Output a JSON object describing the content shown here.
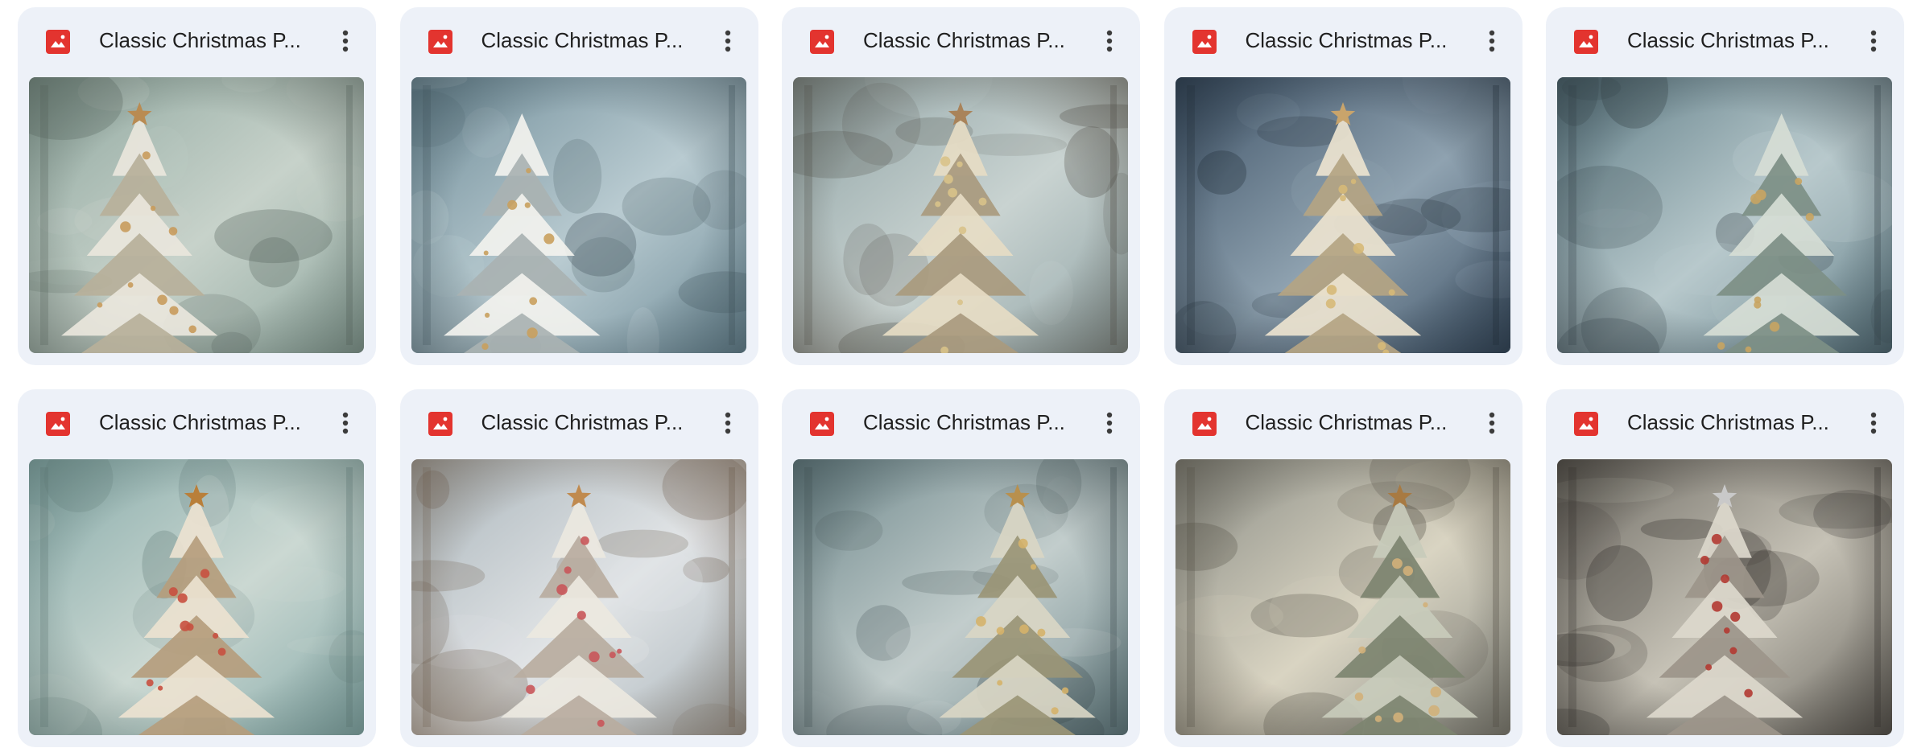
{
  "files": [
    {
      "title": "Classic Christmas P...",
      "icon": "image-file-icon",
      "menu_icon": "more-vert-icon",
      "preview": {
        "bg1": "#8fa79f",
        "bg2": "#c7d2ca",
        "shade": "#4f5c55",
        "tree": "#e9e6dc",
        "tree_dark": "#b7b09a",
        "star": "#b98b52",
        "tree_pos": "left",
        "ornament": "#c89b5c"
      }
    },
    {
      "title": "Classic Christmas P...",
      "icon": "image-file-icon",
      "menu_icon": "more-vert-icon",
      "preview": {
        "bg1": "#6f8c98",
        "bg2": "#b9cbd1",
        "shade": "#3d4f57",
        "tree": "#f2f2ee",
        "tree_dark": "#a9b2b2",
        "star": "",
        "tree_pos": "left",
        "ornament": "#c9a05e"
      }
    },
    {
      "title": "Classic Christmas P...",
      "icon": "image-file-icon",
      "menu_icon": "more-vert-icon",
      "preview": {
        "bg1": "#8ea2a4",
        "bg2": "#c9d3d1",
        "shade": "#4d4a42",
        "tree": "#e6dcc4",
        "tree_dark": "#a99a7e",
        "star": "#a9835a",
        "tree_pos": "center",
        "ornament": "#d8c28a"
      }
    },
    {
      "title": "Classic Christmas P...",
      "icon": "image-file-icon",
      "menu_icon": "more-vert-icon",
      "preview": {
        "bg1": "#3e5266",
        "bg2": "#8fa2b0",
        "shade": "#1f2a35",
        "tree": "#ece3cf",
        "tree_dark": "#b4a483",
        "star": "#c9a46b",
        "tree_pos": "center",
        "ornament": "#d6b978"
      }
    },
    {
      "title": "Classic Christmas P...",
      "icon": "image-file-icon",
      "menu_icon": "more-vert-icon",
      "preview": {
        "bg1": "#5f7c86",
        "bg2": "#b8c9cc",
        "shade": "#2f3c42",
        "tree": "#d6ddd5",
        "tree_dark": "#7d8f86",
        "star": "",
        "tree_pos": "right",
        "ornament": "#c8a462"
      }
    },
    {
      "title": "Classic Christmas P...",
      "icon": "image-file-icon",
      "menu_icon": "more-vert-icon",
      "preview": {
        "bg1": "#86aaa9",
        "bg2": "#cbd8d2",
        "shade": "#566f6c",
        "tree": "#ece2d0",
        "tree_dark": "#b59d7d",
        "star": "#b97f3a",
        "tree_pos": "center",
        "ornament": "#c8503f"
      }
    },
    {
      "title": "Classic Christmas P...",
      "icon": "image-file-icon",
      "menu_icon": "more-vert-icon",
      "preview": {
        "bg1": "#a9b4ba",
        "bg2": "#e1e4e6",
        "shade": "#6a5a4a",
        "tree": "#ece8e0",
        "tree_dark": "#b8aca0",
        "star": "#c08a4e",
        "tree_pos": "center",
        "ornament": "#c9565a"
      }
    },
    {
      "title": "Classic Christmas P...",
      "icon": "image-file-icon",
      "menu_icon": "more-vert-icon",
      "preview": {
        "bg1": "#6e878b",
        "bg2": "#c2cdcc",
        "shade": "#3b4a4d",
        "tree": "#d9d6c4",
        "tree_dark": "#9a9576",
        "star": "#b8904e",
        "tree_pos": "right",
        "ornament": "#d5b36a"
      }
    },
    {
      "title": "Classic Christmas P...",
      "icon": "image-file-icon",
      "menu_icon": "more-vert-icon",
      "preview": {
        "bg1": "#8a8c85",
        "bg2": "#d9d4c2",
        "shade": "#4e4a40",
        "tree": "#c8cbbb",
        "tree_dark": "#7d8470",
        "star": "#a87a42",
        "tree_pos": "right",
        "ornament": "#d2b07a"
      }
    },
    {
      "title": "Classic Christmas P...",
      "icon": "image-file-icon",
      "menu_icon": "more-vert-icon",
      "preview": {
        "bg1": "#6d6a63",
        "bg2": "#c6c2b6",
        "shade": "#2e2b27",
        "tree": "#dcd8cc",
        "tree_dark": "#9c958a",
        "star": "#c9c9c9",
        "tree_pos": "center",
        "ornament": "#b23a32"
      }
    }
  ]
}
